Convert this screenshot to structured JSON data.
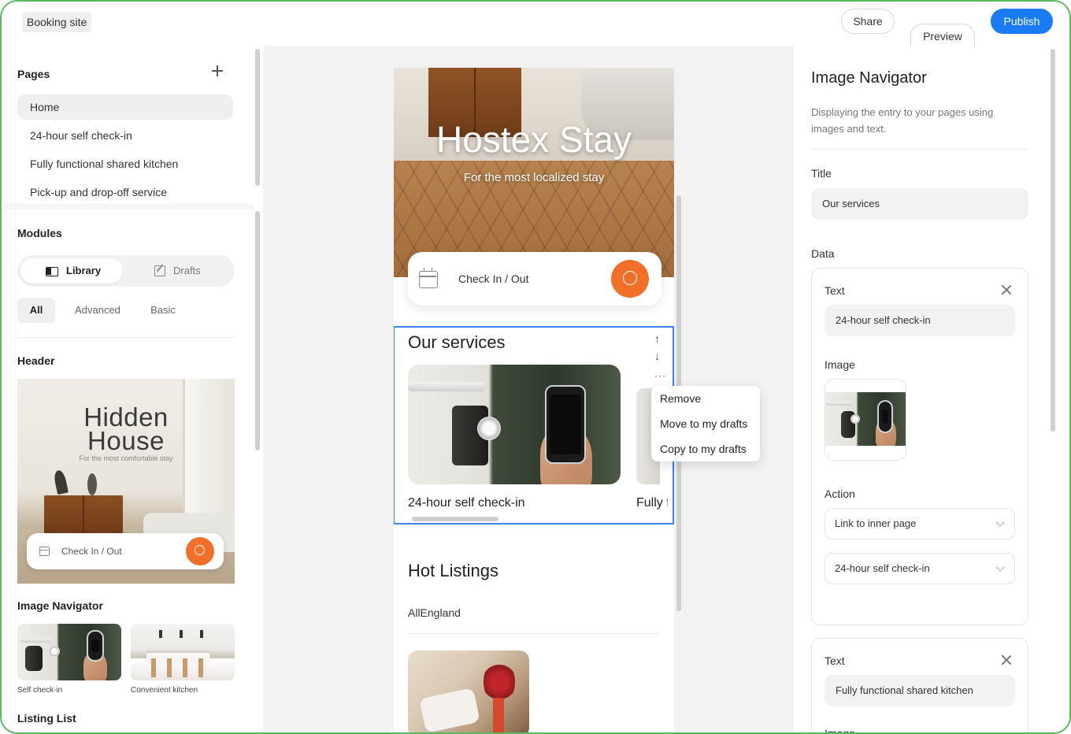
{
  "topbar": {
    "site_name": "Booking site",
    "share_label": "Share",
    "preview_label": "Preview",
    "publish_label": "Publish"
  },
  "pages": {
    "title": "Pages",
    "items": [
      {
        "label": "Home",
        "active": true
      },
      {
        "label": "24-hour self check-in",
        "active": false
      },
      {
        "label": "Fully functional shared kitchen",
        "active": false
      },
      {
        "label": "Pick-up and drop-off service",
        "active": false
      }
    ]
  },
  "modules": {
    "title": "Modules",
    "tabs": {
      "library": "Library",
      "drafts": "Drafts"
    },
    "filters": [
      "All",
      "Advanced",
      "Basic"
    ],
    "header_section": {
      "title": "Header",
      "thumb_title_line1": "Hidden",
      "thumb_title_line2": "House",
      "thumb_subtitle": "For the most comfortable stay",
      "thumb_checkin": "Check In / Out"
    },
    "image_navigator_section": {
      "title": "Image Navigator",
      "thumbs": [
        {
          "caption": "Self check-in"
        },
        {
          "caption": "Convenient kitchen"
        }
      ]
    },
    "listing_list_title": "Listing List"
  },
  "preview": {
    "hero_title": "Hostex Stay",
    "hero_subtitle": "For the most localized stay",
    "checkin_label": "Check In / Out",
    "services": {
      "title": "Our services",
      "cards": [
        {
          "label": "24-hour self check-in"
        },
        {
          "label": "Fully functional shared kitchen"
        }
      ],
      "move_up": "↑",
      "move_down": "↓",
      "more": "···"
    },
    "context_menu": {
      "items": [
        "Remove",
        "Move to my drafts",
        "Copy to my drafts"
      ]
    },
    "hot_listings": {
      "title": "Hot Listings",
      "filter": "AllEngland"
    }
  },
  "inspector": {
    "title": "Image Navigator",
    "description": "Displaying the entry to your pages using images and text.",
    "title_label": "Title",
    "title_value": "Our services",
    "data_label": "Data",
    "entries": [
      {
        "text_label": "Text",
        "text_value": "24-hour self check-in",
        "image_label": "Image",
        "action_label": "Action",
        "action_type": "Link to inner page",
        "action_target": "24-hour self check-in"
      },
      {
        "text_label": "Text",
        "text_value": "Fully functional shared kitchen",
        "image_label": "Image"
      }
    ]
  },
  "colors": {
    "accent": "#1a7cf5",
    "search_button": "#f26f2a",
    "selection_outline": "#3b82f6",
    "frame_border": "#5cb85c"
  }
}
